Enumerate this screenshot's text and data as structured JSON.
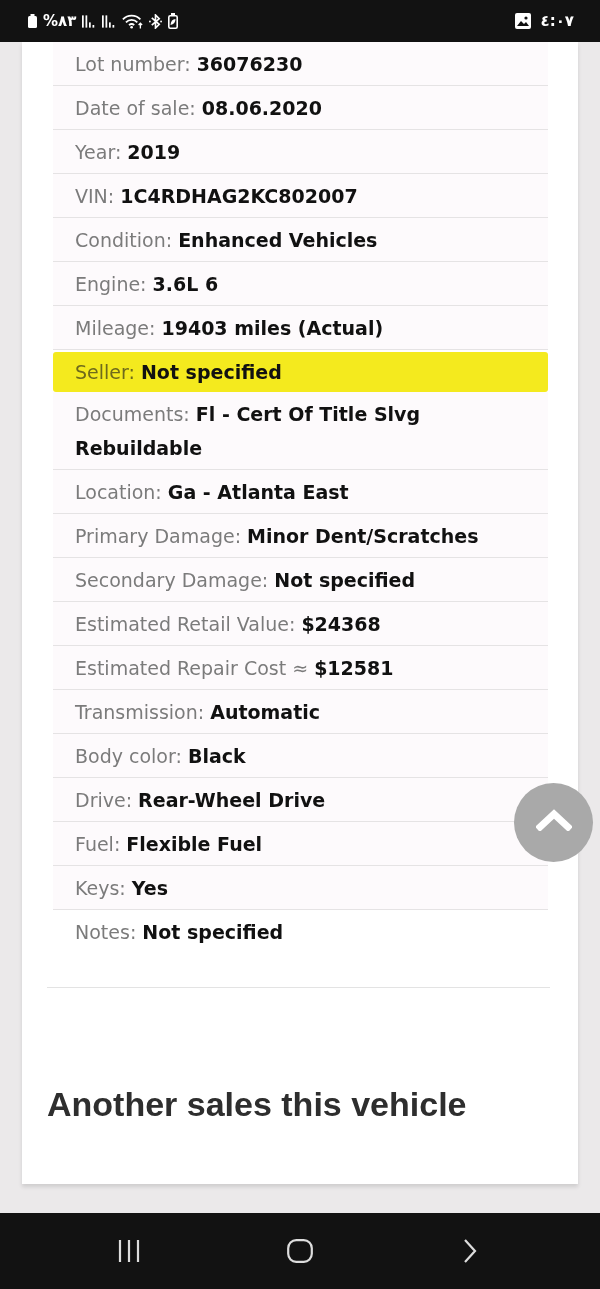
{
  "status_bar": {
    "battery": "%٨٣",
    "time": "٤:٠٧"
  },
  "details": [
    {
      "label": "Lot number:",
      "value": "36076230",
      "highlighted": false
    },
    {
      "label": "Date of sale:",
      "value": "08.06.2020",
      "highlighted": false
    },
    {
      "label": "Year:",
      "value": "2019",
      "highlighted": false
    },
    {
      "label": "VIN:",
      "value": "1C4RDHAG2KC802007",
      "highlighted": false
    },
    {
      "label": "Condition:",
      "value": "Enhanced Vehicles",
      "highlighted": false
    },
    {
      "label": "Engine:",
      "value": "3.6L 6",
      "highlighted": false
    },
    {
      "label": "Mileage:",
      "value": "19403 miles (Actual)",
      "highlighted": false
    },
    {
      "label": "Seller:",
      "value": "Not specified",
      "highlighted": true
    },
    {
      "label": "Documents:",
      "value": "Fl - Cert Of Title Slvg Rebuildable",
      "highlighted": false
    },
    {
      "label": "Location:",
      "value": "Ga - Atlanta East",
      "highlighted": false
    },
    {
      "label": "Primary Damage:",
      "value": "Minor Dent/Scratches",
      "highlighted": false
    },
    {
      "label": "Secondary Damage:",
      "value": "Not specified",
      "highlighted": false
    },
    {
      "label": "Estimated Retail Value:",
      "value": "$24368",
      "highlighted": false
    },
    {
      "label": "Estimated Repair Cost ≈",
      "value": "$12581",
      "highlighted": false
    },
    {
      "label": "Transmission:",
      "value": "Automatic",
      "highlighted": false
    },
    {
      "label": "Body color:",
      "value": "Black",
      "highlighted": false
    },
    {
      "label": "Drive:",
      "value": "Rear-Wheel Drive",
      "highlighted": false
    },
    {
      "label": "Fuel:",
      "value": "Flexible Fuel",
      "highlighted": false
    },
    {
      "label": "Keys:",
      "value": "Yes",
      "highlighted": false
    },
    {
      "label": "Notes:",
      "value": "Not specified",
      "highlighted": false
    }
  ],
  "section_heading": "Another sales this vehicle"
}
